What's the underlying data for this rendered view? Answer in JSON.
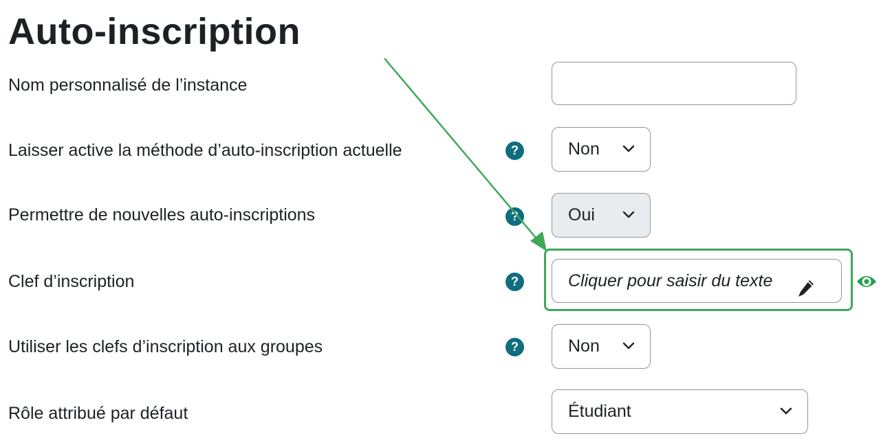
{
  "page": {
    "title": "Auto-inscription"
  },
  "fields": {
    "instance_name": {
      "label": "Nom personnalisé de l’instance",
      "value": ""
    },
    "keep_active": {
      "label": "Laisser active la méthode d’auto-inscription actuelle",
      "value": "Non",
      "help_icon": "question-circle"
    },
    "allow_new": {
      "label": "Permettre de nouvelles auto-inscriptions",
      "value": "Oui",
      "help_icon": "question-circle"
    },
    "enrol_key": {
      "label": "Clef d’inscription",
      "placeholder": "Cliquer pour saisir du texte",
      "edit_icon": "pencil",
      "reveal_icon": "eye",
      "help_icon": "question-circle"
    },
    "group_keys": {
      "label": "Utiliser les clefs d’inscription aux groupes",
      "value": "Non",
      "help_icon": "question-circle"
    },
    "default_role": {
      "label": "Rôle attribué par défaut",
      "value": "Étudiant"
    }
  },
  "icons": {
    "help_glyph": "?",
    "chevron": "chevron-down"
  },
  "colors": {
    "help_icon": "#0f6d7e",
    "annotation": "#3ea75a",
    "reveal_icon": "#1fa04a",
    "disabled_select_bg": "#e9ecef"
  }
}
